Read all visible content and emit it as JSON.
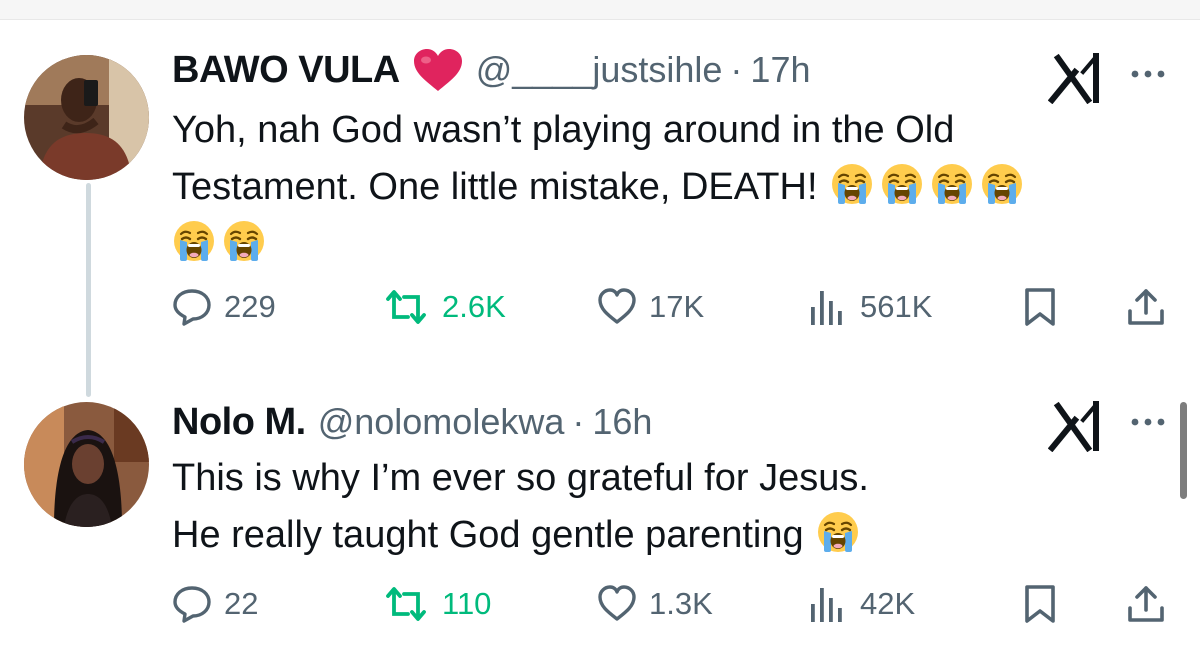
{
  "tweets": [
    {
      "name": "BAWO VULA",
      "handle": "@____justsihle",
      "separator": "·",
      "time": "17h",
      "text_line1": "Yoh, nah God wasn’t playing around in the Old",
      "text_line2": "Testament. One little mistake, DEATH!",
      "emoji_count": 6,
      "replies": "229",
      "reposts": "2.6K",
      "likes": "17K",
      "views": "561K"
    },
    {
      "name": "Nolo M.",
      "handle": "@nolomolekwa",
      "separator": "·",
      "time": "16h",
      "text_line1": "This is why I’m ever so grateful for Jesus.",
      "text_line2": "He really taught God gentle parenting",
      "emoji_count": 1,
      "replies": "22",
      "reposts": "110",
      "likes": "1.3K",
      "views": "42K"
    }
  ],
  "icons": {
    "reply": "speech-bubble-icon",
    "repost": "repost-arrows-icon",
    "like": "heart-outline-icon",
    "views": "bar-chart-icon",
    "bookmark": "bookmark-icon",
    "share": "share-upload-icon",
    "grok": "grok-icon",
    "more": "more-dots-icon",
    "emoji": "loudly-crying-face-emoji"
  },
  "colors": {
    "text": "#0f1419",
    "secondary": "#536471",
    "repost_green": "#00ba7c",
    "thread_line": "#cfd9de",
    "heart_red": "#e0245e"
  }
}
